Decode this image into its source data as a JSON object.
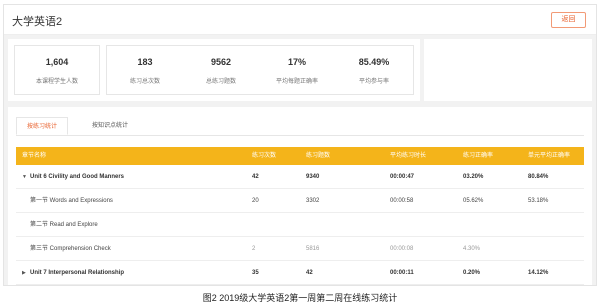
{
  "header": {
    "title": "大学英语2",
    "return_label": "返回"
  },
  "stats": [
    {
      "value": "1,604",
      "label": "本课程学生人数"
    },
    {
      "value": "183",
      "label": "练习总次数"
    },
    {
      "value": "9562",
      "label": "总练习题数"
    },
    {
      "value": "17%",
      "label": "平均每题正确率"
    },
    {
      "value": "85.49%",
      "label": "平均参与率"
    }
  ],
  "tabs": [
    {
      "label": "按练习统计"
    },
    {
      "label": "按知识点统计"
    }
  ],
  "table": {
    "columns": [
      "章节名称",
      "练习次数",
      "练习题数",
      "平均练习时长",
      "练习正确率",
      "单元平均正确率"
    ],
    "rows": [
      {
        "caret": "▼",
        "name": "Unit 6 Civility and Good Manners",
        "count": "42",
        "questions": "9340",
        "duration": "00:00:47",
        "accuracy": "03.20%",
        "unit_avg": "80.84%",
        "style": "strong"
      },
      {
        "caret": "",
        "name": "第一节 Words and Expressions",
        "count": "20",
        "questions": "3302",
        "duration": "00:00:58",
        "accuracy": "05.62%",
        "unit_avg": "53.18%",
        "style": "normal"
      },
      {
        "caret": "",
        "name": "第二节 Read and Explore",
        "count": "",
        "questions": "",
        "duration": "",
        "accuracy": "",
        "unit_avg": "",
        "style": "normal"
      },
      {
        "caret": "",
        "name": "第三节 Comprehension Check",
        "count": "2",
        "questions": "5816",
        "duration": "00:00:08",
        "accuracy": "4.30%",
        "unit_avg": "",
        "style": "faint"
      },
      {
        "caret": "▶",
        "name": "Unit 7 Interpersonal Relationship",
        "count": "35",
        "questions": "42",
        "duration": "00:00:11",
        "accuracy": "0.20%",
        "unit_avg": "14.12%",
        "style": "strong"
      }
    ]
  },
  "caption": "图2 2019级大学英语2第一周第二周在线练习统计",
  "colors": {
    "accent": "#f4b41a",
    "orange_text": "#e8602c"
  }
}
